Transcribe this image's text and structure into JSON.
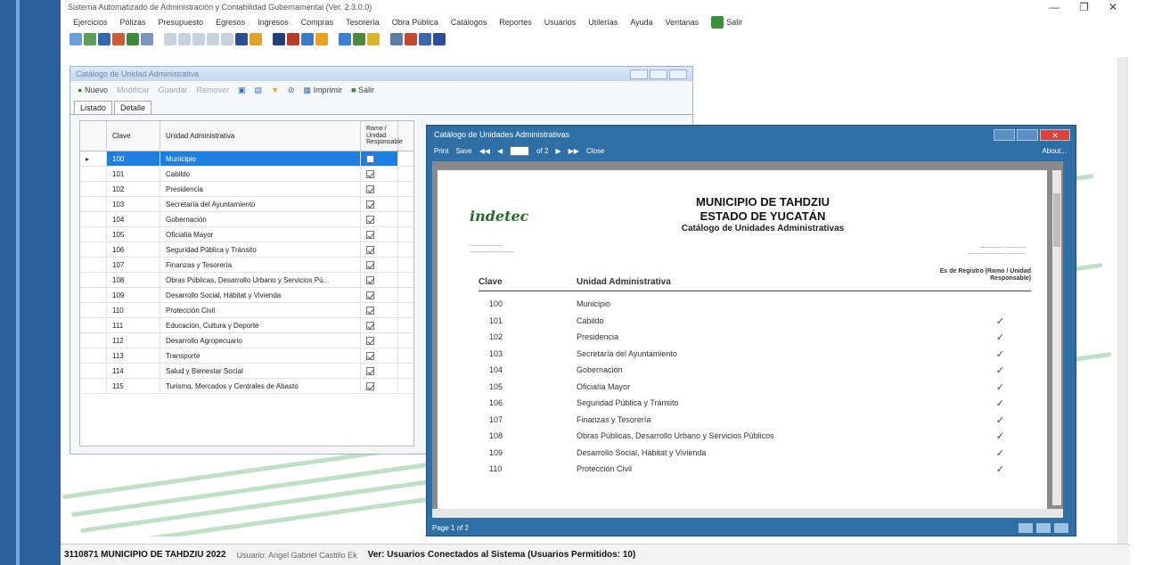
{
  "app": {
    "window_title": "Sistema Automatizado de Administración y Contabilidad Gubernamental (Ver. 2.3.0.0)",
    "win_controls": [
      "—",
      "❐",
      "✕"
    ]
  },
  "menu": [
    "Ejercicios",
    "Pólizas",
    "Presupuesto",
    "Egresos",
    "Ingresos",
    "Compras",
    "Tesorería",
    "Obra Pública",
    "Catálogos",
    "Reportes",
    "Usuarios",
    "Utilerías",
    "Ayuda",
    "Ventanas",
    "Salir"
  ],
  "catalog_window": {
    "title": "Catálogo de Unidad Administrativa",
    "toolbar": {
      "nuevo": "Nuevo",
      "modificar": "Modificar",
      "guardar": "Guardar",
      "remover": "Remover",
      "imprimir": "Imprimir",
      "salir": "Salir"
    },
    "tabs": [
      "Listado",
      "Detalle"
    ],
    "grid": {
      "headers": {
        "clave": "Clave",
        "unidad": "Unidad Administrativa",
        "ramo": "Ramo / Unidad Responsable"
      },
      "rows": [
        {
          "clave": "100",
          "unidad": "Municipio",
          "checked": false,
          "selected": true
        },
        {
          "clave": "101",
          "unidad": "Cabildo",
          "checked": true
        },
        {
          "clave": "102",
          "unidad": "Presidencia",
          "checked": true
        },
        {
          "clave": "103",
          "unidad": "Secretaría del Ayuntamiento",
          "checked": true
        },
        {
          "clave": "104",
          "unidad": "Gobernación",
          "checked": true
        },
        {
          "clave": "105",
          "unidad": "Oficialía Mayor",
          "checked": true
        },
        {
          "clave": "106",
          "unidad": "Seguridad Pública y Tránsito",
          "checked": true
        },
        {
          "clave": "107",
          "unidad": "Finanzas y Tesorería",
          "checked": true
        },
        {
          "clave": "108",
          "unidad": "Obras Públicas, Desarrollo Urbano y Servicios Pú...",
          "checked": true
        },
        {
          "clave": "109",
          "unidad": "Desarrollo Social, Hábitat y Vivienda",
          "checked": true
        },
        {
          "clave": "110",
          "unidad": "Protección Civil",
          "checked": true
        },
        {
          "clave": "111",
          "unidad": "Educación, Cultura y Deporte",
          "checked": true
        },
        {
          "clave": "112",
          "unidad": "Desarrollo Agropecuario",
          "checked": true
        },
        {
          "clave": "113",
          "unidad": "Transporte",
          "checked": true
        },
        {
          "clave": "114",
          "unidad": "Salud y Bienestar Social",
          "checked": true
        },
        {
          "clave": "115",
          "unidad": "Turismo, Mercados y Centrales de Abasto",
          "checked": true
        }
      ]
    }
  },
  "report_window": {
    "title": "Catálogo de Unidades Administrativas",
    "toolbar": {
      "print": "Print",
      "save": "Save",
      "page_of": "of 2",
      "close": "Close",
      "about": "About..."
    },
    "page": {
      "logo": "indetec",
      "h1": "MUNICIPIO DE TAHDZIU",
      "h2": "ESTADO DE YUCATÁN",
      "h3": "Catálogo de Unidades Administrativas",
      "col_clave": "Clave",
      "col_unidad": "Unidad Administrativa",
      "col_ramo": "Es de Registro (Ramo / Unidad Responsable)",
      "rows": [
        {
          "clave": "100",
          "unidad": "Municipio",
          "check": ""
        },
        {
          "clave": "101",
          "unidad": "Cabildo",
          "check": "✓"
        },
        {
          "clave": "102",
          "unidad": "Presidencia",
          "check": "✓"
        },
        {
          "clave": "103",
          "unidad": "Secretaría del Ayuntamiento",
          "check": "✓"
        },
        {
          "clave": "104",
          "unidad": "Gobernación",
          "check": "✓"
        },
        {
          "clave": "105",
          "unidad": "Oficialía Mayor",
          "check": "✓"
        },
        {
          "clave": "106",
          "unidad": "Seguridad Pública y Tránsito",
          "check": "✓"
        },
        {
          "clave": "107",
          "unidad": "Finanzas y Tesorería",
          "check": "✓"
        },
        {
          "clave": "108",
          "unidad": "Obras Públicas, Desarrollo Urbano y Servicios Públicos",
          "check": "✓"
        },
        {
          "clave": "109",
          "unidad": "Desarrollo Social, Hábitat y Vivienda",
          "check": "✓"
        },
        {
          "clave": "110",
          "unidad": "Protección Civil",
          "check": "✓"
        }
      ]
    },
    "status": "Page 1 of 2"
  },
  "statusbar": {
    "entity": "3110871 MUNICIPIO DE TAHDZIU  2022",
    "user": "Usuario: Angel Gabriel Castillo Ek",
    "connected": "Ver: Usuarios Conectados al Sistema  (Usuarios Permitidos: 10)"
  },
  "colors": {
    "selection": "#1e7fe0",
    "report_frame": "#2e6fa6",
    "close_red": "#d9433a",
    "logo_green": "#2a6a2f"
  }
}
